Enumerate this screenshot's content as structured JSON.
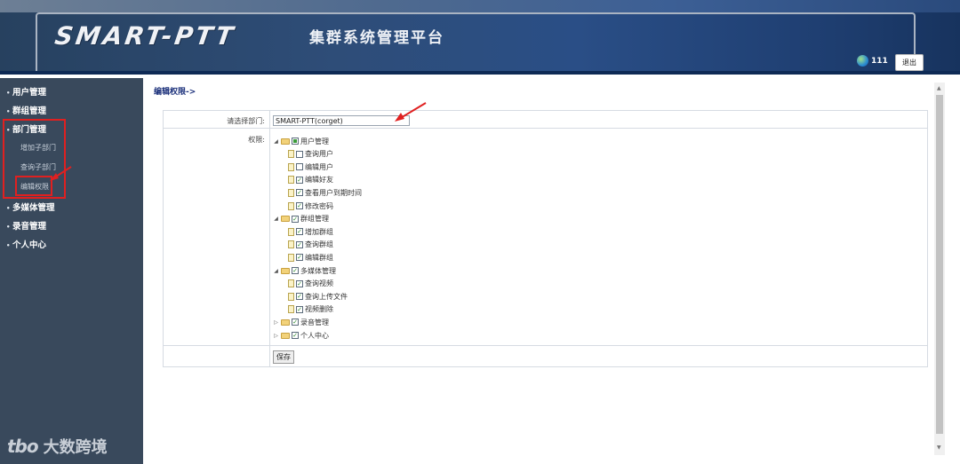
{
  "header": {
    "logo": "SMART-PTT",
    "subtitle": "集群系统管理平台",
    "username": "111",
    "logout_label": "退出"
  },
  "sidebar": {
    "items": [
      {
        "label": "用户管理"
      },
      {
        "label": "群组管理"
      },
      {
        "label": "部门管理"
      },
      {
        "label": "多媒体管理"
      },
      {
        "label": "录音管理"
      },
      {
        "label": "个人中心"
      }
    ],
    "subitems": [
      {
        "label": "增加子部门"
      },
      {
        "label": "查询子部门"
      },
      {
        "label": "编辑权限"
      }
    ],
    "watermark": "大数跨境",
    "watermark_logo": "tbo"
  },
  "main": {
    "breadcrumb": "编辑权限->",
    "dept_label": "请选择部门:",
    "dept_value": "SMART-PTT(corget)",
    "perm_label": "权限:",
    "save_label": "保存",
    "tree": [
      {
        "label": "用户管理",
        "state": "partial",
        "expanded": true,
        "children": [
          {
            "label": "查询用户",
            "checked": false
          },
          {
            "label": "编辑用户",
            "checked": false
          },
          {
            "label": "编辑好友",
            "checked": true
          },
          {
            "label": "查看用户到期时间",
            "checked": true
          },
          {
            "label": "修改密码",
            "checked": true
          }
        ]
      },
      {
        "label": "群组管理",
        "state": "checked",
        "expanded": true,
        "children": [
          {
            "label": "增加群组",
            "checked": true
          },
          {
            "label": "查询群组",
            "checked": true
          },
          {
            "label": "编辑群组",
            "checked": true
          }
        ]
      },
      {
        "label": "多媒体管理",
        "state": "checked",
        "expanded": true,
        "children": [
          {
            "label": "查询视频",
            "checked": true
          },
          {
            "label": "查询上传文件",
            "checked": true
          },
          {
            "label": "视频删除",
            "checked": true
          }
        ]
      },
      {
        "label": "录音管理",
        "state": "checked",
        "expanded": false,
        "children": []
      },
      {
        "label": "个人中心",
        "state": "checked",
        "expanded": false,
        "children": []
      }
    ]
  },
  "colors": {
    "sidebar_bg": "#39495c",
    "highlight_red": "#e02020",
    "breadcrumb": "#1a2f7a"
  }
}
